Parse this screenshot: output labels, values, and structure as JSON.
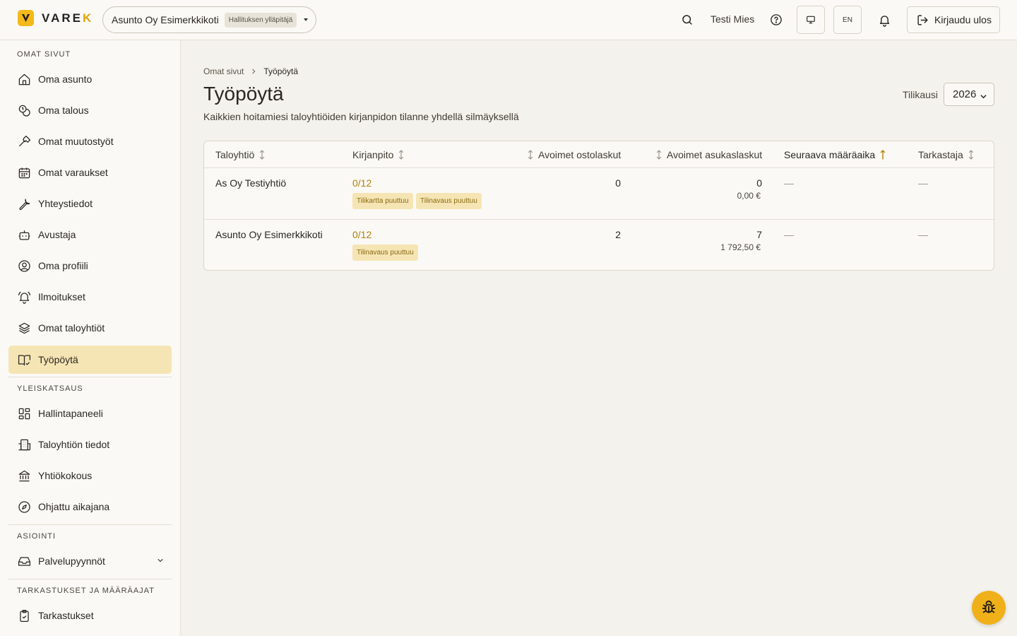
{
  "header": {
    "logo_text_main": "VARE",
    "logo_text_accent": "K",
    "company": "Asunto Oy Esimerkkikoti",
    "role": "Hallituksen ylläpitäjä",
    "user": "Testi Mies",
    "lang": "EN",
    "logout": "Kirjaudu ulos"
  },
  "sidebar": {
    "sections": [
      {
        "title": "OMAT SIVUT",
        "items": [
          {
            "label": "Oma asunto",
            "icon": "home-icon"
          },
          {
            "label": "Oma talous",
            "icon": "coins-icon"
          },
          {
            "label": "Omat muutostyöt",
            "icon": "hammer-icon"
          },
          {
            "label": "Omat varaukset",
            "icon": "calendar-icon"
          },
          {
            "label": "Yhteystiedot",
            "icon": "wrench-icon"
          },
          {
            "label": "Avustaja",
            "icon": "bot-icon"
          },
          {
            "label": "Oma profiili",
            "icon": "user-circle-icon"
          },
          {
            "label": "Ilmoitukset",
            "icon": "bell-ring-icon"
          },
          {
            "label": "Omat taloyhtiöt",
            "icon": "layers-icon"
          },
          {
            "label": "Työpöytä",
            "icon": "book-check-icon",
            "active": true
          }
        ]
      },
      {
        "title": "YLEISKATSAUS",
        "items": [
          {
            "label": "Hallintapaneeli",
            "icon": "dashboard-icon"
          },
          {
            "label": "Taloyhtiön tiedot",
            "icon": "building-icon"
          },
          {
            "label": "Yhtiökokous",
            "icon": "landmark-icon"
          },
          {
            "label": "Ohjattu aikajana",
            "icon": "compass-icon"
          }
        ]
      },
      {
        "title": "ASIOINTI",
        "items": [
          {
            "label": "Palvelupyynnöt",
            "icon": "inbox-icon"
          }
        ]
      },
      {
        "title": "TARKASTUKSET JA MÄÄRÄAJAT",
        "items": [
          {
            "label": "Tarkastukset",
            "icon": "clipboard-check-icon"
          }
        ]
      }
    ]
  },
  "main": {
    "breadcrumb": [
      "Omat sivut",
      "Työpöytä"
    ],
    "title": "Työpöytä",
    "subtitle": "Kaikkien hoitamiesi taloyhtiöiden kirjanpidon tilanne yhdellä silmäyksellä",
    "fiscal_label": "Tilikausi",
    "fiscal_year": "2026",
    "table": {
      "headers": [
        "Taloyhtiö",
        "Kirjanpito",
        "Avoimet ostolaskut",
        "Avoimet asukaslaskut",
        "Seuraava määräaika",
        "Tarkastaja"
      ],
      "rows": [
        {
          "company": "As Oy Testiyhtiö",
          "progress": "0/12",
          "tags": [
            "Tilikartta puuttuu",
            "Tilinavaus puuttuu"
          ],
          "purchase": "0",
          "resident": "0",
          "resident_sum": "0,00 €",
          "deadline": "—",
          "auditor": "—"
        },
        {
          "company": "Asunto Oy Esimerkkikoti",
          "progress": "0/12",
          "tags": [
            "Tilinavaus puuttuu"
          ],
          "purchase": "2",
          "resident": "7",
          "resident_sum": "1 792,50 €",
          "deadline": "—",
          "auditor": "—"
        }
      ]
    }
  },
  "colors": {
    "accent": "#f3b81a",
    "active_bg": "#f6e5b4",
    "progress": "#b3800a"
  }
}
